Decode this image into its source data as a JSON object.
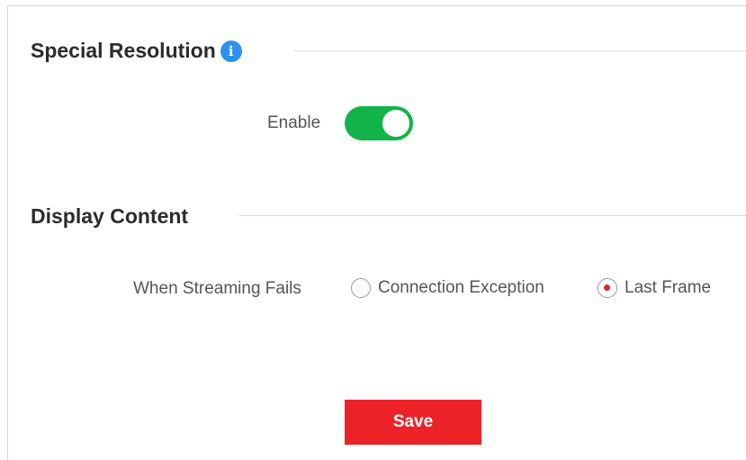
{
  "special_resolution": {
    "title": "Special Resolution",
    "info_icon": "info-icon",
    "enable_label": "Enable",
    "enabled": true
  },
  "display_content": {
    "title": "Display Content",
    "streaming_fails_label": "When Streaming Fails",
    "options": [
      {
        "label": "Connection Exception",
        "selected": false
      },
      {
        "label": "Last Frame",
        "selected": true
      }
    ]
  },
  "actions": {
    "save_label": "Save"
  },
  "colors": {
    "toggle_on": "#12b44a",
    "save_button": "#ec2228",
    "radio_selected": "#e8222c",
    "info_icon": "#2f8ff0"
  }
}
